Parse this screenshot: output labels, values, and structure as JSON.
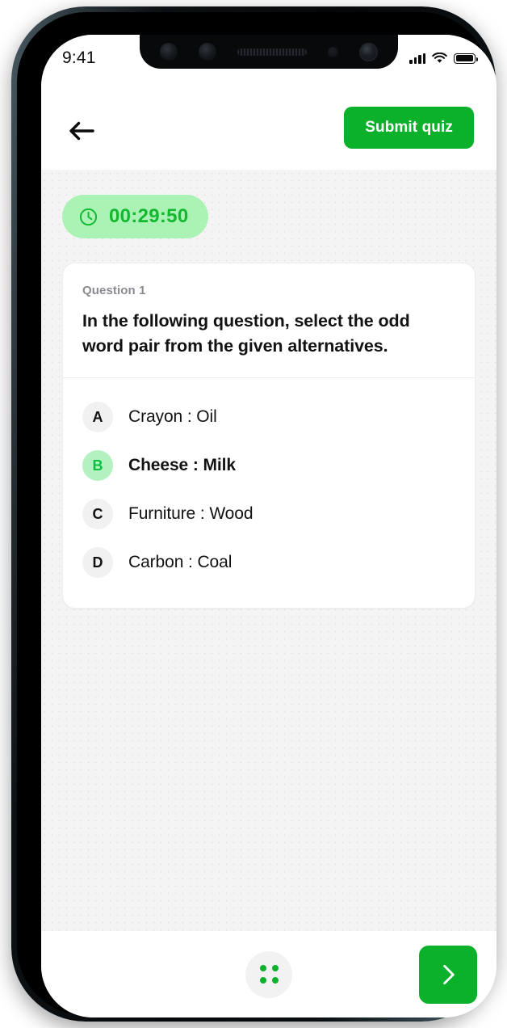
{
  "status_bar": {
    "time": "9:41",
    "signal_icon": "cellular-signal-icon",
    "wifi_icon": "wifi-icon",
    "battery_icon": "battery-full-icon"
  },
  "header": {
    "back_icon": "back-arrow-icon",
    "submit_label": "Submit quiz"
  },
  "timer": {
    "clock_icon": "clock-icon",
    "value": "00:29:50"
  },
  "question": {
    "label": "Question 1",
    "text": "In the following question, select the odd word pair from the given alternatives."
  },
  "options": [
    {
      "letter": "A",
      "text": "Crayon : Oil",
      "selected": false
    },
    {
      "letter": "B",
      "text": "Cheese : Milk",
      "selected": true
    },
    {
      "letter": "C",
      "text": "Furniture : Wood",
      "selected": false
    },
    {
      "letter": "D",
      "text": "Carbon : Coal",
      "selected": false
    }
  ],
  "bottom_bar": {
    "grid_icon": "grid-dots-icon",
    "next_icon": "chevron-right-icon"
  },
  "colors": {
    "brand_green": "#0bb02b",
    "timer_bg": "#aaf3b5",
    "timer_text": "#13b82f",
    "selected_circle_bg": "#b3f2c0",
    "selected_letter": "#0cbf3f",
    "page_bg": "#f4f4f5",
    "card_bg": "#ffffff"
  }
}
